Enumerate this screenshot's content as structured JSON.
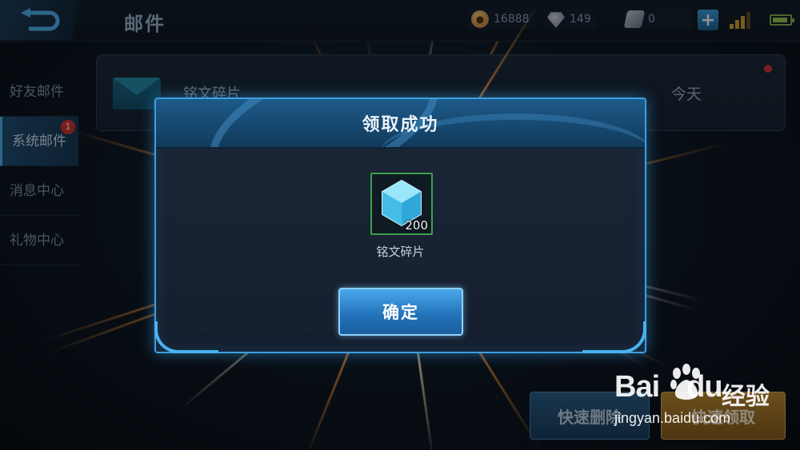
{
  "header": {
    "title": "邮件",
    "back_icon": "back-arrow-icon",
    "resources": [
      {
        "name": "gold-coin",
        "value": "16888"
      },
      {
        "name": "diamond",
        "value": "149"
      },
      {
        "name": "coupon",
        "value": "0"
      }
    ],
    "plus_icon": "plus-icon",
    "signal_icon": "signal-icon",
    "battery_icon": "battery-icon"
  },
  "sidebar": {
    "items": [
      {
        "label": "好友邮件"
      },
      {
        "label": "系统邮件",
        "badge": "1"
      },
      {
        "label": "消息中心"
      },
      {
        "label": "礼物中心"
      }
    ]
  },
  "mail_list": {
    "rows": [
      {
        "icon": "envelope-icon",
        "name": "铭文碎片",
        "date": "今天"
      }
    ]
  },
  "actions": {
    "delete_label": "快速删除",
    "claim_label": "快速领取"
  },
  "dialog": {
    "title": "领取成功",
    "reward": {
      "icon": "crystal-icon",
      "count": "200",
      "name": "铭文碎片"
    },
    "confirm_label": "确定"
  },
  "watermark": {
    "logo": "Bai",
    "logo_tail": "du",
    "brand": "经验",
    "url": "jingyan.baidu.com"
  },
  "colors": {
    "accent": "#3c9fe0",
    "badge": "#d9302b",
    "reward_border": "#39a24c"
  }
}
